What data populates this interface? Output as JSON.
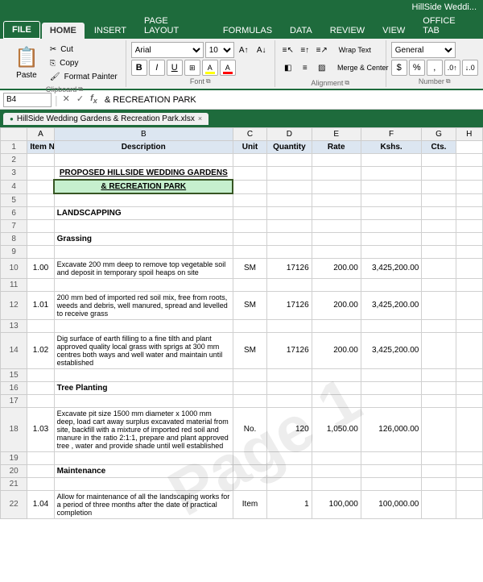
{
  "titleBar": {
    "text": "HillSide Weddi..."
  },
  "ribbonTabs": [
    {
      "label": "FILE",
      "active": true,
      "isFile": true
    },
    {
      "label": "HOME",
      "active": true
    },
    {
      "label": "INSERT",
      "active": false
    },
    {
      "label": "PAGE LAYOUT",
      "active": false
    },
    {
      "label": "FORMULAS",
      "active": false
    },
    {
      "label": "DATA",
      "active": false
    },
    {
      "label": "REVIEW",
      "active": false
    },
    {
      "label": "VIEW",
      "active": false
    },
    {
      "label": "OFFICE TAB",
      "active": false
    }
  ],
  "clipboard": {
    "paste_label": "Paste",
    "cut_label": "✂ Cut",
    "copy_label": "📋 Copy",
    "format_label": "Format Painter",
    "group_label": "Clipboard"
  },
  "font": {
    "name": "Arial",
    "size": "10",
    "bold": "B",
    "italic": "I",
    "underline": "U",
    "group_label": "Font"
  },
  "alignment": {
    "group_label": "Alignment",
    "wrap_text": "Wrap Text",
    "merge_center": "Merge & Center"
  },
  "number": {
    "format": "General",
    "currency": "$",
    "percent": "%",
    "comma": ",",
    "dec_inc": ".0",
    "dec_dec": ".00",
    "group_label": "Number"
  },
  "formulaBar": {
    "nameBox": "B4",
    "formula": "& RECREATION PARK"
  },
  "sheetTab": {
    "label": "HillSide Wedding Gardens & Recreation Park.xlsx",
    "close": "×"
  },
  "columns": [
    {
      "label": "",
      "key": "row"
    },
    {
      "label": "A"
    },
    {
      "label": "B"
    },
    {
      "label": "C"
    },
    {
      "label": "D"
    },
    {
      "label": "E"
    },
    {
      "label": "F"
    },
    {
      "label": "G"
    },
    {
      "label": "H"
    }
  ],
  "headerRow": {
    "colA": "Item No.",
    "colB": "Description",
    "colC": "Unit",
    "colD": "Quantity",
    "colE": "Rate",
    "colF": "Kshs.",
    "colG": "Cts."
  },
  "rows": [
    {
      "num": "1",
      "a": "Item No.",
      "b": "Description",
      "c": "Unit",
      "d": "Quantity",
      "e": "Rate",
      "f": "Kshs.",
      "g": "Cts.",
      "isHeader": true
    },
    {
      "num": "2",
      "a": "",
      "b": "",
      "c": "",
      "d": "",
      "e": "",
      "f": "",
      "g": ""
    },
    {
      "num": "3",
      "a": "",
      "b": "PROPOSED HILLSIDE WEDDING GARDENS",
      "c": "",
      "d": "",
      "e": "",
      "f": "",
      "g": "",
      "boldUnderline": true,
      "center": true
    },
    {
      "num": "4",
      "a": "",
      "b": "& RECREATION PARK",
      "c": "",
      "d": "",
      "e": "",
      "f": "",
      "g": "",
      "boldUnderline": true,
      "center": true,
      "selected": true
    },
    {
      "num": "5",
      "a": "",
      "b": "",
      "c": "",
      "d": "",
      "e": "",
      "f": "",
      "g": ""
    },
    {
      "num": "6",
      "a": "",
      "b": "LANDSCAPPING",
      "c": "",
      "d": "",
      "e": "",
      "f": "",
      "g": "",
      "bold": true
    },
    {
      "num": "7",
      "a": "",
      "b": "",
      "c": "",
      "d": "",
      "e": "",
      "f": "",
      "g": ""
    },
    {
      "num": "8",
      "a": "",
      "b": "Grassing",
      "c": "",
      "d": "",
      "e": "",
      "f": "",
      "g": "",
      "bold": true
    },
    {
      "num": "9",
      "a": "",
      "b": "",
      "c": "",
      "d": "",
      "e": "",
      "f": "",
      "g": ""
    },
    {
      "num": "10",
      "a": "1.00",
      "b": "Excavate 200 mm deep to remove top vegetable soil and deposit in temporary spoil heaps on site",
      "c": "SM",
      "d": "17126",
      "e": "200.00",
      "f": "3,425,200.00",
      "g": "",
      "wrap": true
    },
    {
      "num": "11",
      "a": "",
      "b": "",
      "c": "",
      "d": "",
      "e": "",
      "f": "",
      "g": ""
    },
    {
      "num": "12",
      "a": "1.01",
      "b": "200 mm bed of imported red soil mix, free from roots, weeds and debris, well manured, spread and levelled to receive grass",
      "c": "SM",
      "d": "17126",
      "e": "200.00",
      "f": "3,425,200.00",
      "g": "",
      "wrap": true
    },
    {
      "num": "13",
      "a": "",
      "b": "",
      "c": "",
      "d": "",
      "e": "",
      "f": "",
      "g": ""
    },
    {
      "num": "14",
      "a": "1.02",
      "b": "Dig surface of earth filling to a fine tilth and plant approved quality local grass with sprigs at 300 mm centres both ways and well water and maintain until established",
      "c": "SM",
      "d": "17126",
      "e": "200.00",
      "f": "3,425,200.00",
      "g": "",
      "wrap": true
    },
    {
      "num": "15",
      "a": "",
      "b": "",
      "c": "",
      "d": "",
      "e": "",
      "f": "",
      "g": ""
    },
    {
      "num": "16",
      "a": "",
      "b": "Tree Planting",
      "c": "",
      "d": "",
      "e": "",
      "f": "",
      "g": "",
      "bold": true
    },
    {
      "num": "17",
      "a": "",
      "b": "",
      "c": "",
      "d": "",
      "e": "",
      "f": "",
      "g": ""
    },
    {
      "num": "18",
      "a": "1.03",
      "b": "Excavate pit size 1500 mm diameter x 1000 mm deep, load cart away surplus excavated material from site, backfill with a mixture of imported red soil and manure in the ratio 2:1:1, prepare and plant approved tree , water and provide shade until well established",
      "c": "No.",
      "d": "120",
      "e": "1,050.00",
      "f": "126,000.00",
      "g": "",
      "wrap": true
    },
    {
      "num": "19",
      "a": "",
      "b": "",
      "c": "",
      "d": "",
      "e": "",
      "f": "",
      "g": ""
    },
    {
      "num": "20",
      "a": "",
      "b": "Maintenance",
      "c": "",
      "d": "",
      "e": "",
      "f": "",
      "g": "",
      "bold": true
    },
    {
      "num": "21",
      "a": "",
      "b": "",
      "c": "",
      "d": "",
      "e": "",
      "f": "",
      "g": ""
    },
    {
      "num": "22",
      "a": "1.04",
      "b": "Allow for maintenance of all the landscaping works for a period of three months after the date of practical completion",
      "c": "Item",
      "d": "1",
      "e": "100,000",
      "f": "100,000.00",
      "g": "",
      "wrap": true
    }
  ],
  "watermark": "Page 1"
}
